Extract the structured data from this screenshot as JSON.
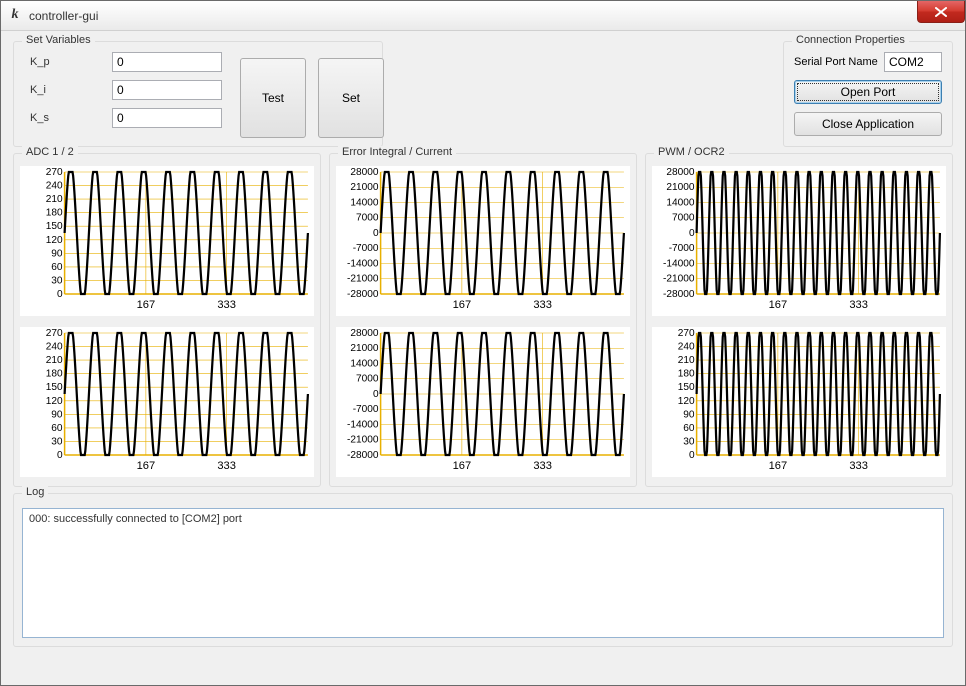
{
  "window": {
    "title": "controller-gui",
    "icon_char": "k"
  },
  "set_variables": {
    "legend": "Set Variables",
    "fields": {
      "kp_label": "K_p",
      "kp_value": "0",
      "ki_label": "K_i",
      "ki_value": "0",
      "ks_label": "K_s",
      "ks_value": "0"
    },
    "test_label": "Test",
    "set_label": "Set"
  },
  "connection": {
    "legend": "Connection Properties",
    "serial_label": "Serial Port Name",
    "serial_value": "COM2",
    "open_label": "Open Port",
    "close_app_label": "Close Application"
  },
  "charts": {
    "adc_legend": "ADC 1 / 2",
    "err_legend": "Error Integral / Current",
    "pwm_legend": "PWM / OCR2"
  },
  "log": {
    "legend": "Log",
    "text": "000: successfully connected to [COM2] port"
  },
  "chart_data": {
    "x_ticks": [
      167,
      333
    ],
    "x_range": [
      0,
      500
    ],
    "adc": {
      "y_ticks": [
        0,
        30,
        60,
        90,
        120,
        150,
        180,
        210,
        240,
        270
      ],
      "y_range": [
        0,
        270
      ],
      "top_cycles": 10,
      "bottom_cycles": 10
    },
    "error": {
      "y_ticks": [
        -28000,
        -21000,
        -14000,
        -7000,
        0,
        7000,
        14000,
        21000,
        28000
      ],
      "y_range": [
        -28000,
        28000
      ],
      "top_cycles": 10,
      "bottom_cycles": 10
    },
    "pwm": {
      "top_y_ticks": [
        -28000,
        -21000,
        -14000,
        -7000,
        0,
        7000,
        14000,
        21000,
        28000
      ],
      "top_y_range": [
        -28000,
        28000
      ],
      "top_cycles": 20,
      "bottom_y_ticks": [
        0,
        30,
        60,
        90,
        120,
        150,
        180,
        210,
        240,
        270
      ],
      "bottom_y_range": [
        0,
        270
      ],
      "bottom_cycles": 20
    }
  }
}
